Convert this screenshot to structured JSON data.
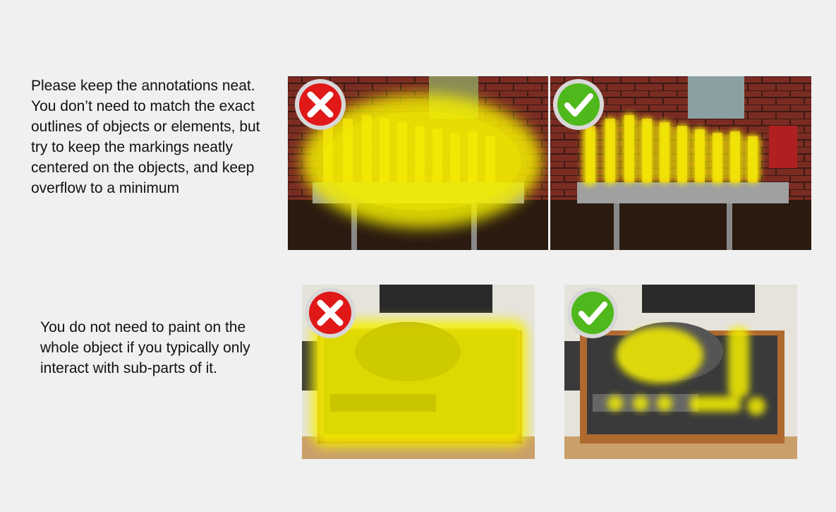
{
  "instructions": {
    "neatness": "Please keep the annotations neat. You don’t need to match the exact outlines of objects or elements, but try to keep the markings neatly centered on the objects, and keep overflow to a minimum",
    "sub_parts": "You do not need to paint on the whole object if you typically only interact with sub-parts of it."
  },
  "examples": [
    {
      "subject": "beer taps",
      "verdict": "incorrect",
      "badge_icon": "red-x-icon"
    },
    {
      "subject": "beer taps",
      "verdict": "correct",
      "badge_icon": "green-check-icon"
    },
    {
      "subject": "turntable",
      "verdict": "incorrect",
      "badge_icon": "red-x-icon"
    },
    {
      "subject": "turntable",
      "verdict": "correct",
      "badge_icon": "green-check-icon"
    }
  ],
  "colors": {
    "background": "#f0f0f0",
    "highlight": "#f5f000",
    "badge_red": "#e01818",
    "badge_green": "#4fb81c"
  }
}
